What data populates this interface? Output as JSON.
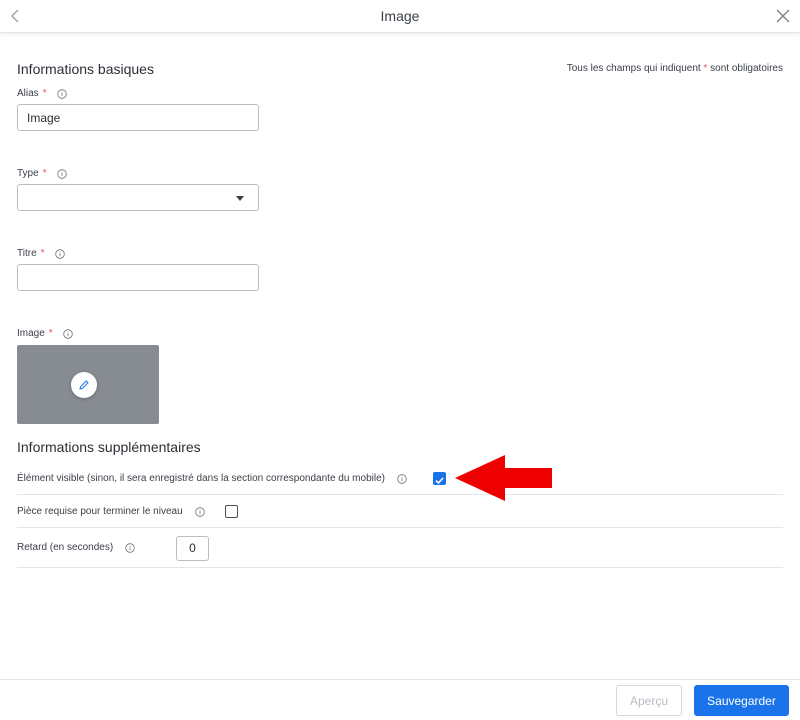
{
  "header": {
    "title": "Image",
    "back_icon": "chevron-left-icon",
    "close_icon": "close-icon"
  },
  "basic": {
    "section_title": "Informations basiques",
    "required_note_prefix": "Tous les champs qui indiquent",
    "required_note_star": "*",
    "required_note_suffix": "sont obligatoires",
    "alias": {
      "label": "Alias",
      "star": "*",
      "value": "Image"
    },
    "type": {
      "label": "Type",
      "star": "*",
      "value": ""
    },
    "titre": {
      "label": "Titre",
      "star": "*",
      "value": ""
    },
    "image": {
      "label": "Image",
      "star": "*"
    }
  },
  "extra": {
    "section_title": "Informations supplémentaires",
    "visible": {
      "label": "Élément visible (sinon, il sera enregistré dans la section correspondante du mobile)",
      "checked": true
    },
    "piece": {
      "label": "Pièce requise pour terminer le niveau",
      "checked": false
    },
    "retard": {
      "label": "Retard (en secondes)",
      "value": "0"
    }
  },
  "footer": {
    "preview_label": "Aperçu",
    "save_label": "Sauvegarder"
  },
  "colors": {
    "accent": "#1a73e8",
    "required": "#e8505b",
    "annotation_arrow": "#ee0000",
    "image_placeholder": "#878b92"
  }
}
